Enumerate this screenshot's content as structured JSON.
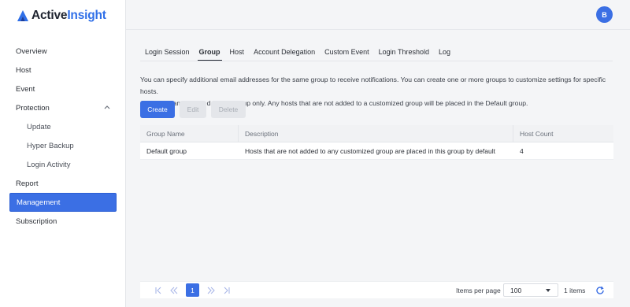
{
  "brand": {
    "name_part1": "Active",
    "name_part2": "Insight",
    "accent": "#2f6fe8"
  },
  "user": {
    "avatar_initial": "B"
  },
  "sidebar": {
    "items": [
      {
        "label": "Overview"
      },
      {
        "label": "Host"
      },
      {
        "label": "Event"
      },
      {
        "label": "Protection"
      },
      {
        "label": "Update"
      },
      {
        "label": "Hyper Backup"
      },
      {
        "label": "Login Activity"
      },
      {
        "label": "Report"
      },
      {
        "label": "Management"
      },
      {
        "label": "Subscription"
      }
    ]
  },
  "tabs": [
    {
      "label": "Login Session"
    },
    {
      "label": "Group"
    },
    {
      "label": "Host"
    },
    {
      "label": "Account Delegation"
    },
    {
      "label": "Custom Event"
    },
    {
      "label": "Login Threshold"
    },
    {
      "label": "Log"
    }
  ],
  "description": {
    "line1": "You can specify additional email addresses for the same group to receive notifications. You can create one or more groups to customize settings for specific hosts.",
    "line2": "One host can be added to one group only. Any hosts that are not added to a customized group will be placed in the Default group."
  },
  "toolbar": {
    "create": "Create",
    "edit": "Edit",
    "delete": "Delete"
  },
  "table": {
    "headers": [
      "Group Name",
      "Description",
      "Host Count"
    ],
    "rows": [
      [
        "Default group",
        "Hosts that are not added to any customized group are placed in this group by default",
        "4"
      ]
    ]
  },
  "pagination": {
    "current_page": "1",
    "items_per_page_label": "Items per page",
    "items_per_page_value": "100",
    "items_count": "1 items"
  }
}
